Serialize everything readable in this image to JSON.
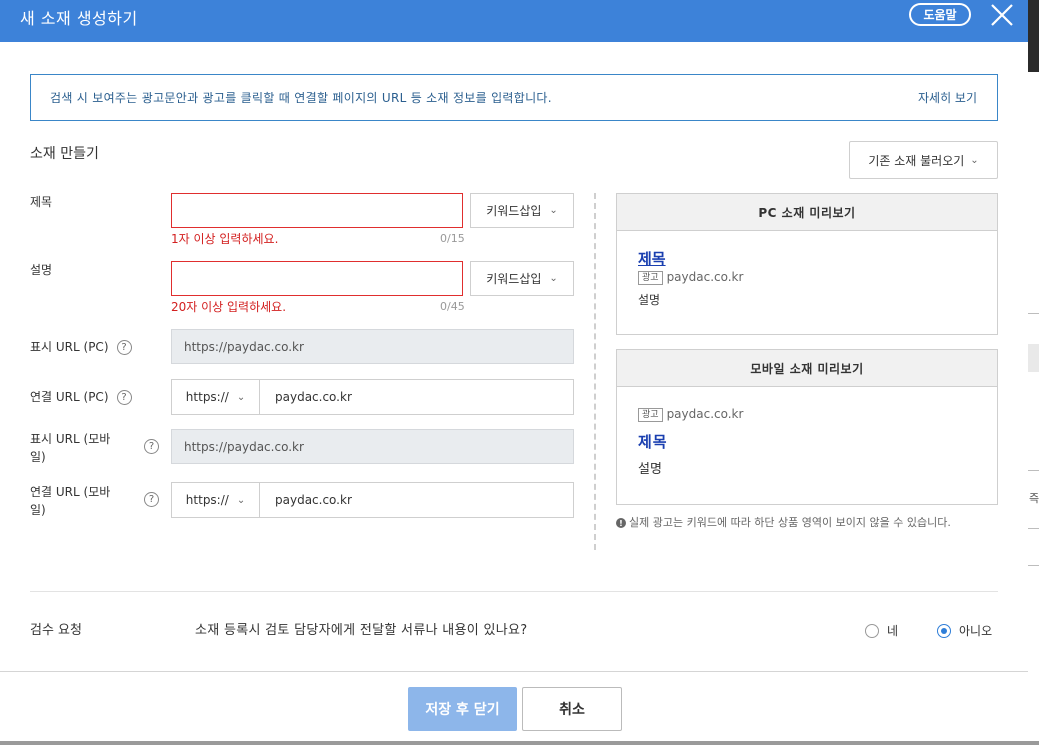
{
  "header": {
    "title": "새 소재 생성하기",
    "help_label": "도움말"
  },
  "info": {
    "text": "검색 시 보여주는 광고문안과 광고를 클릭할 때 연결할 페이지의 URL 등 소재 정보를 입력합니다.",
    "more_label": "자세히 보기"
  },
  "section": {
    "title": "소재 만들기",
    "load_label": "기존 소재 불러오기"
  },
  "form": {
    "title": {
      "label": "제목",
      "value": "",
      "error": "1자 이상 입력하세요.",
      "counter": "0/15",
      "kw_label": "키워드삽입"
    },
    "desc": {
      "label": "설명",
      "value": "",
      "error": "20자 이상 입력하세요.",
      "counter": "0/45",
      "kw_label": "키워드삽입"
    },
    "display_url_pc": {
      "label": "표시 URL (PC)",
      "value": "https://paydac.co.kr"
    },
    "link_url_pc": {
      "label": "연결 URL (PC)",
      "protocol": "https://",
      "value": "paydac.co.kr"
    },
    "display_url_m": {
      "label_line1": "표시 URL (모바",
      "label_line2": "일)",
      "value": "https://paydac.co.kr"
    },
    "link_url_m": {
      "label_line1": "연결 URL (모바",
      "label_line2": "일)",
      "protocol": "https://",
      "value": "paydac.co.kr"
    }
  },
  "preview_pc": {
    "header": "PC 소재 미리보기",
    "title": "제목",
    "badge": "광고",
    "url": "paydac.co.kr",
    "desc": "설명"
  },
  "preview_m": {
    "header": "모바일 소재 미리보기",
    "badge": "광고",
    "url": "paydac.co.kr",
    "title": "제목",
    "desc": "설명"
  },
  "notice": {
    "text": "실제 광고는 키워드에 따라 하단 상품 영역이 보이지 않을 수 있습니다."
  },
  "review": {
    "label": "검수 요청",
    "question": "소재 등록시 검토 담당자에게 전달할 서류나 내용이 있나요?",
    "options": [
      {
        "label": "네",
        "selected": false
      },
      {
        "label": "아니오",
        "selected": true
      }
    ]
  },
  "footer": {
    "save_label": "저장 후 닫기",
    "cancel_label": "취소"
  },
  "colors": {
    "header_bg": "#3d82d9",
    "error": "#e02e2e",
    "primary_disabled": "#8db6ea",
    "link": "#1a3fb0"
  },
  "icons": {
    "close": "close-icon",
    "help": "question-icon",
    "chevron": "chevron-down-icon",
    "notice": "exclamation-icon"
  },
  "background": {
    "side_glyph": "즉"
  }
}
